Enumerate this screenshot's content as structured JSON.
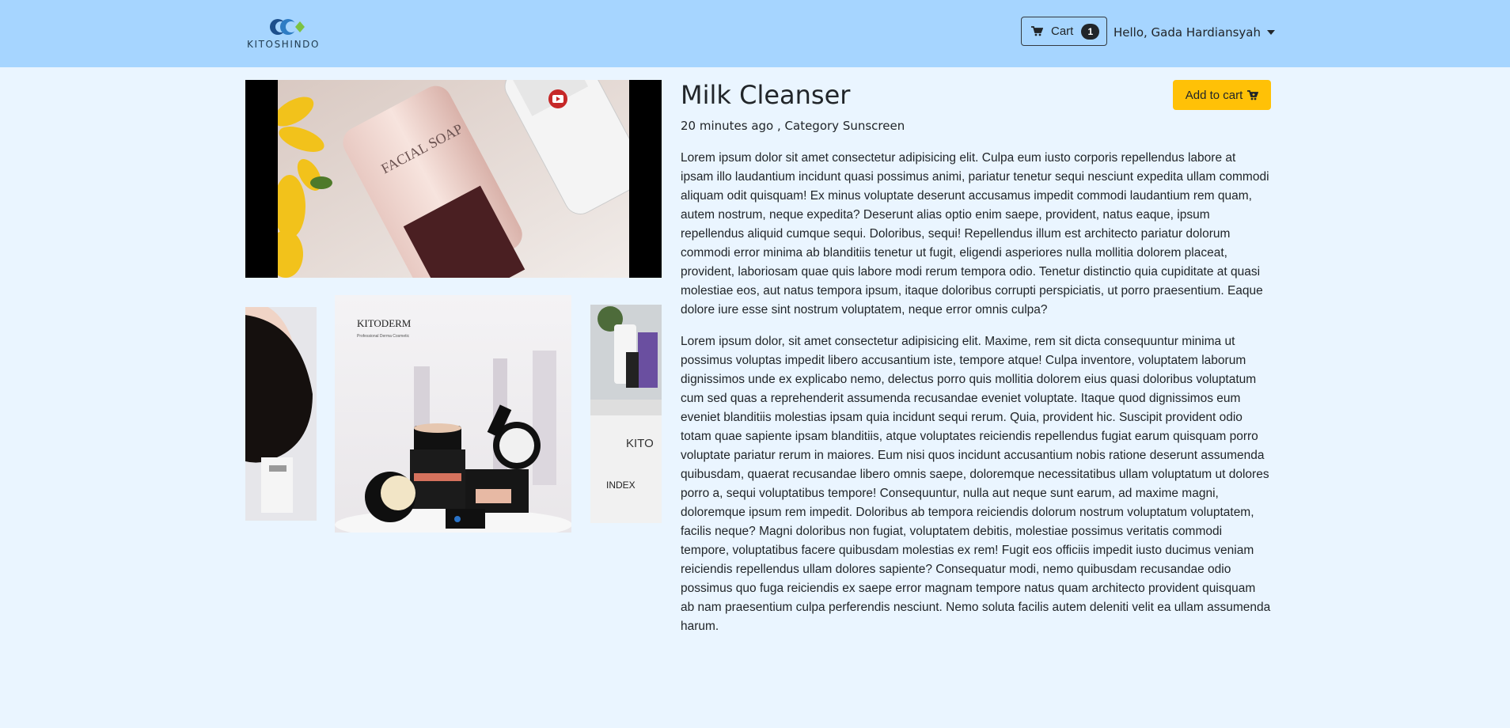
{
  "navbar": {
    "brand": "KITOSHINDO",
    "cart_label": "Cart",
    "cart_count": "1",
    "user_greeting": "Hello, Gada Hardiansyah"
  },
  "video": {
    "icon": "youtube-icon"
  },
  "carousel": {
    "slides": [
      {
        "alt": "model-slide"
      },
      {
        "alt": "KITODERM",
        "tagline": "Professional Derma Cosmetic"
      },
      {
        "alt": "KITO",
        "tagline": "INDEX"
      }
    ]
  },
  "product": {
    "title": "Milk Cleanser",
    "meta": "20 minutes ago , Category Sunscreen",
    "add_to_cart_label": "Add to cart",
    "description_1": "Lorem ipsum dolor sit amet consectetur adipisicing elit. Culpa eum iusto corporis repellendus labore at ipsam illo laudantium incidunt quasi possimus animi, pariatur tenetur sequi nesciunt expedita ullam commodi aliquam odit quisquam! Ex minus voluptate deserunt accusamus impedit commodi laudantium rem quam, autem nostrum, neque expedita? Deserunt alias optio enim saepe, provident, natus eaque, ipsum repellendus aliquid cumque sequi. Doloribus, sequi! Repellendus illum est architecto pariatur dolorum commodi error minima ab blanditiis tenetur ut fugit, eligendi asperiores nulla mollitia dolorem placeat, provident, laboriosam quae quis labore modi rerum tempora odio. Tenetur distinctio quia cupiditate at quasi molestiae eos, aut natus tempora ipsum, itaque doloribus corrupti perspiciatis, ut porro praesentium. Eaque dolore iure esse sint nostrum voluptatem, neque error omnis culpa?",
    "description_2": "Lorem ipsum dolor, sit amet consectetur adipisicing elit. Maxime, rem sit dicta consequuntur minima ut possimus voluptas impedit libero accusantium iste, tempore atque! Culpa inventore, voluptatem laborum dignissimos unde ex explicabo nemo, delectus porro quis mollitia dolorem eius quasi doloribus voluptatum cum sed quas a reprehenderit assumenda recusandae eveniet voluptate. Itaque quod dignissimos eum eveniet blanditiis molestias ipsam quia incidunt sequi rerum. Quia, provident hic. Suscipit provident odio totam quae sapiente ipsam blanditiis, atque voluptates reiciendis repellendus fugiat earum quisquam porro voluptate pariatur rerum in maiores. Eum nisi quos incidunt accusantium nobis ratione deserunt assumenda quibusdam, quaerat recusandae libero omnis saepe, doloremque necessitatibus ullam voluptatum ut dolores porro a, sequi voluptatibus tempore! Consequuntur, nulla aut neque sunt earum, ad maxime magni, doloremque ipsum rem impedit. Doloribus ab tempora reiciendis dolorum nostrum voluptatum voluptatem, facilis neque? Magni doloribus non fugiat, voluptatem debitis, molestiae possimus veritatis commodi tempore, voluptatibus facere quibusdam molestias ex rem! Fugit eos officiis impedit iusto ducimus veniam reiciendis repellendus ullam dolores sapiente? Consequatur modi, nemo quibusdam recusandae odio possimus quo fuga reiciendis ex saepe error magnam tempore natus quam architecto provident quisquam ab nam praesentium culpa perferendis nesciunt. Nemo soluta facilis autem deleniti velit ea ullam assumenda harum."
  },
  "colors": {
    "navbar_bg": "#a6d5ff",
    "page_bg": "#eaf5ff",
    "add_button_bg": "#ffc107"
  }
}
